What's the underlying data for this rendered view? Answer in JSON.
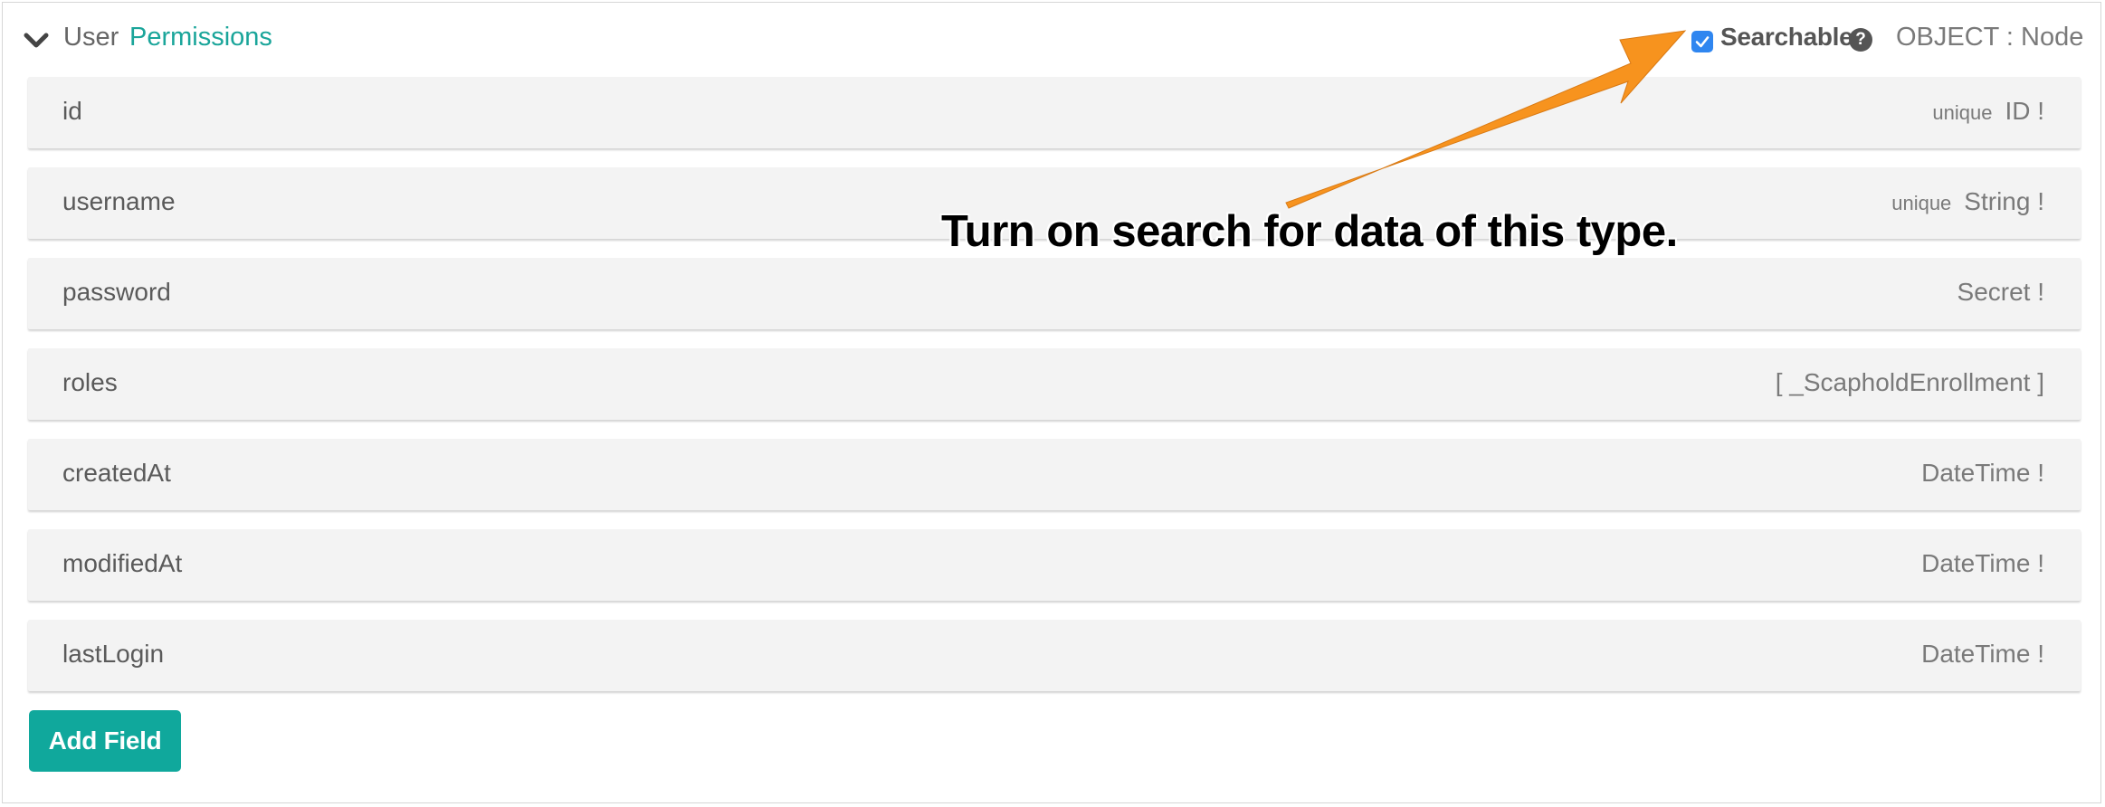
{
  "header": {
    "type_name": "User",
    "permissions_link": "Permissions",
    "searchable_label": "Searchable",
    "searchable_checked": true,
    "help_glyph": "?",
    "object_label": "OBJECT : Node"
  },
  "fields": [
    {
      "name": "id",
      "modifier": "unique",
      "type": "ID !"
    },
    {
      "name": "username",
      "modifier": "unique",
      "type": "String !"
    },
    {
      "name": "password",
      "modifier": "",
      "type": "Secret !"
    },
    {
      "name": "roles",
      "modifier": "",
      "type": "[ _ScapholdEnrollment ]"
    },
    {
      "name": "createdAt",
      "modifier": "",
      "type": "DateTime !"
    },
    {
      "name": "modifiedAt",
      "modifier": "",
      "type": "DateTime !"
    },
    {
      "name": "lastLogin",
      "modifier": "",
      "type": "DateTime !"
    }
  ],
  "add_field_label": "Add Field",
  "annotation": {
    "text": "Turn on search for data of this type.",
    "arrow_color": "#f7931e"
  },
  "colors": {
    "accent": "#10a89c",
    "link": "#1aa59a",
    "checkbox": "#2f86f0"
  },
  "icons": {
    "collapse": "chevron-down-icon",
    "checkbox": "checkbox-checked-icon",
    "help": "question-circle-icon",
    "annotation": "arrow-icon"
  }
}
